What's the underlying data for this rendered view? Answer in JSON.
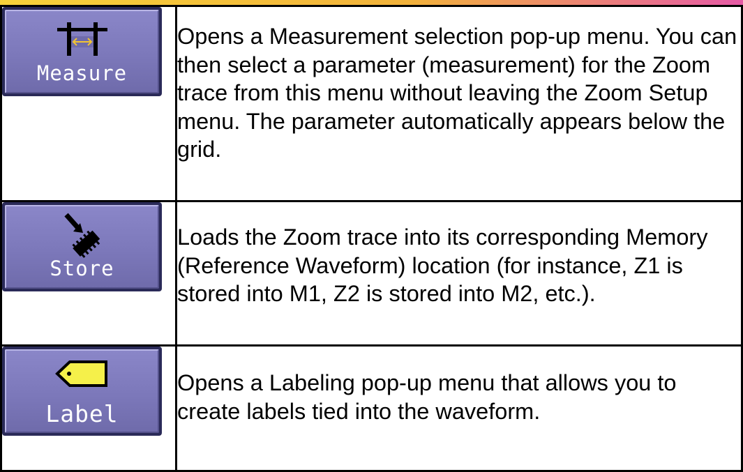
{
  "rows": [
    {
      "button_label": "Measure",
      "icon": "measure-cursor-icon",
      "description": "Opens a Measurement selection pop-up menu.  You can then select a parameter (measurement) for the Zoom trace from this menu without leaving the Zoom Setup menu. The parameter automatically appears below the grid."
    },
    {
      "button_label": "Store",
      "icon": "store-chip-icon",
      "description": "Loads the Zoom trace into its corresponding Memory (Reference Waveform) location (for instance, Z1 is stored into M1, Z2 is stored into M2, etc.)."
    },
    {
      "button_label": "Label",
      "icon": "label-tag-icon",
      "description": "Opens a Labeling pop-up menu that allows you to create labels tied into the waveform."
    }
  ],
  "colors": {
    "button_face": "#7c78ba",
    "button_border": "#2a2a58",
    "button_text": "#ffffff",
    "label_tag": "#f5f04a",
    "measure_arrow": "#f2c431"
  }
}
